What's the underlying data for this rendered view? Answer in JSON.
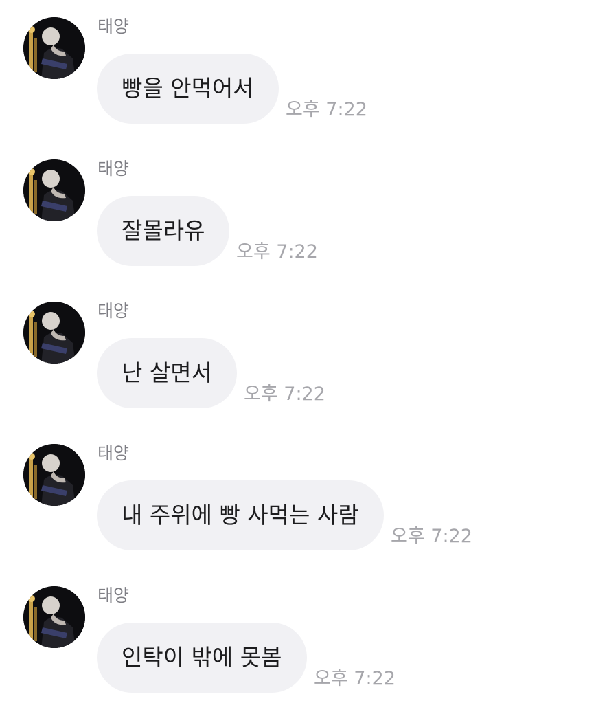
{
  "messages": [
    {
      "sender": "태양",
      "text": "빵을 안먹어서",
      "time": "오후 7:22"
    },
    {
      "sender": "태양",
      "text": "잘몰라유",
      "time": "오후 7:22"
    },
    {
      "sender": "태양",
      "text": "난 살면서",
      "time": "오후 7:22"
    },
    {
      "sender": "태양",
      "text": "내 주위에 빵 사먹는 사람",
      "time": "오후 7:22"
    },
    {
      "sender": "태양",
      "text": "인탁이 밖에 못봄",
      "time": "오후 7:22"
    }
  ],
  "colors": {
    "bubble": "#f1f1f4",
    "sender": "#7e7e84",
    "time": "#a6a6ab",
    "text": "#1c1c1e"
  },
  "icons": {
    "avatar": "profile-photo"
  }
}
